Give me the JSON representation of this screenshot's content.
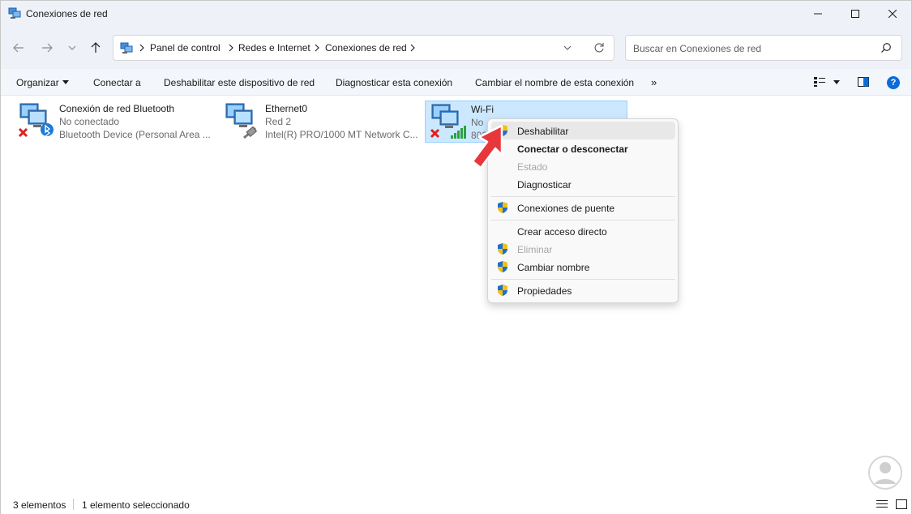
{
  "window": {
    "title": "Conexiones de red"
  },
  "address": {
    "crumbs": [
      "Panel de control",
      "Redes e Internet",
      "Conexiones de red"
    ]
  },
  "search": {
    "placeholder": "Buscar en Conexiones de red"
  },
  "commands": {
    "organize": "Organizar",
    "connect": "Conectar a",
    "disable": "Deshabilitar este dispositivo de red",
    "diagnose": "Diagnosticar esta conexión",
    "rename": "Cambiar el nombre de esta conexión",
    "more": "»"
  },
  "connections": [
    {
      "name": "Conexión de red Bluetooth",
      "status": "No conectado",
      "device": "Bluetooth Device (Personal Area ...",
      "icon": "bluetooth-network-icon"
    },
    {
      "name": "Ethernet0",
      "status": "Red 2",
      "device": "Intel(R) PRO/1000 MT Network C...",
      "icon": "ethernet-network-icon"
    },
    {
      "name": "Wi-Fi",
      "status": "No",
      "device": "802",
      "icon": "wifi-network-icon"
    }
  ],
  "context_menu": {
    "items": [
      {
        "label": "Deshabilitar",
        "shield": true,
        "style": "hover"
      },
      {
        "label": "Conectar o desconectar",
        "shield": false,
        "style": "bold"
      },
      {
        "label": "Estado",
        "shield": false,
        "style": "disabled"
      },
      {
        "label": "Diagnosticar",
        "shield": false,
        "style": "normal"
      },
      {
        "label": "Conexiones de puente",
        "shield": true,
        "style": "normal"
      },
      {
        "label": "Crear acceso directo",
        "shield": false,
        "style": "normal"
      },
      {
        "label": "Eliminar",
        "shield": true,
        "style": "disabled"
      },
      {
        "label": "Cambiar nombre",
        "shield": true,
        "style": "normal"
      },
      {
        "label": "Propiedades",
        "shield": true,
        "style": "normal"
      }
    ]
  },
  "status_bar": {
    "count": "3 elementos",
    "selected": "1 elemento seleccionado"
  },
  "colors": {
    "selection": "#cce8ff",
    "accent": "#0a6cd8",
    "arrow": "#e8373b"
  }
}
